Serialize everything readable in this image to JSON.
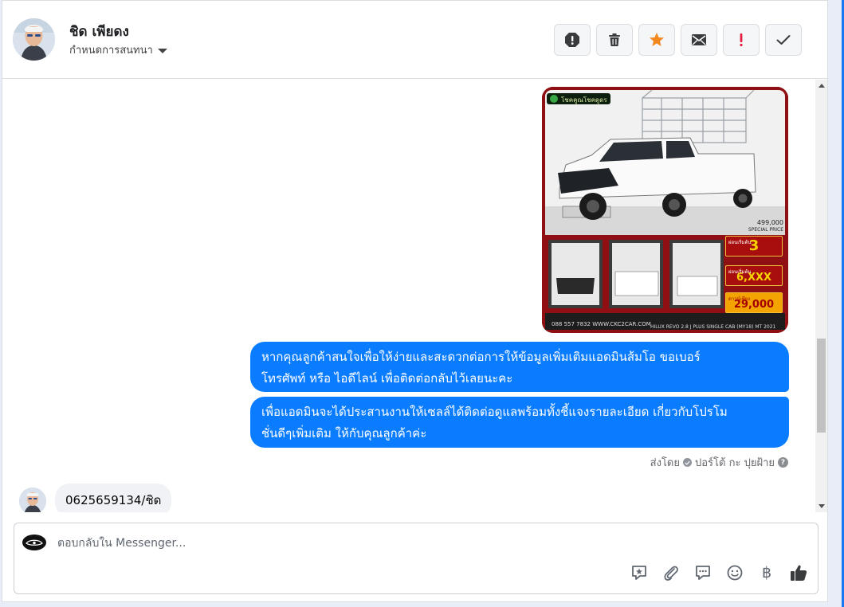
{
  "header": {
    "name": "ชิด เพียดง",
    "assign_label": "กำหนดการสนทนา",
    "actions": [
      {
        "name": "report-icon",
        "label": "!"
      },
      {
        "name": "trash-icon",
        "label": ""
      },
      {
        "name": "star-icon",
        "label": ""
      },
      {
        "name": "mail-icon",
        "label": ""
      },
      {
        "name": "follow-up-icon",
        "label": "!"
      },
      {
        "name": "done-check-icon",
        "label": ""
      }
    ]
  },
  "thread": {
    "image": {
      "banner": "โชคคูณโชคดูดร",
      "price": "499,000",
      "price_caption": "SPECIAL PRICE",
      "promo": [
        {
          "small": "ผ่อนเริ่มต้น",
          "big": "3"
        },
        {
          "small": "ผ่อนเริ่มต้น",
          "big": "6,XXX"
        },
        {
          "small": "ดาวน์เพียง",
          "big": "29,000"
        }
      ],
      "phone": "088 557 7832",
      "website": "WWW.CKC2CAR.COM",
      "model": "HILUX REVO 2.8 J PLUS SINGLE CAB (MY18) MT 2021"
    },
    "outgoing": [
      {
        "lines": [
          "หากคุณลูกค้าสนใจเพื่อให้ง่ายและสะดวกต่อการให้ข้อมูลเพิ่มเติมแอดมินส้มโอ ขอเบอร์",
          "โทรศัพท์ หรือ ไอดีไลน์ เพื่อติดต่อกลับไว้เลยนะคะ"
        ]
      },
      {
        "lines": [
          "เพื่อแอดมินจะได้ประสานงานให้เซลล์ได้ติดต่อดูแลพร้อมทั้งชี้แจงรายละเอียด เกี่ยวกับโปรโม",
          "ชั่นดีๆเพิ่มเติม ให้กับคุณลูกค้าค่ะ"
        ]
      }
    ],
    "sent_by_label": "ส่งโดย",
    "sent_by_name": "ปอร์โต้ กะ ปุยฝ้าย",
    "incoming": "0625659134/ชิด"
  },
  "composer": {
    "placeholder": "ตอบกลับใน Messenger...",
    "tools": [
      "saved-reply-icon",
      "attachment-icon",
      "comment-icon",
      "emoji-icon",
      "baht-icon",
      "like-icon"
    ],
    "baht_symbol": "฿"
  },
  "colors": {
    "outgoing_bubble": "#0a7cff",
    "incoming_bubble": "#f0f2f5",
    "star": "#f5871f",
    "follow_up": "#e41e3f"
  }
}
